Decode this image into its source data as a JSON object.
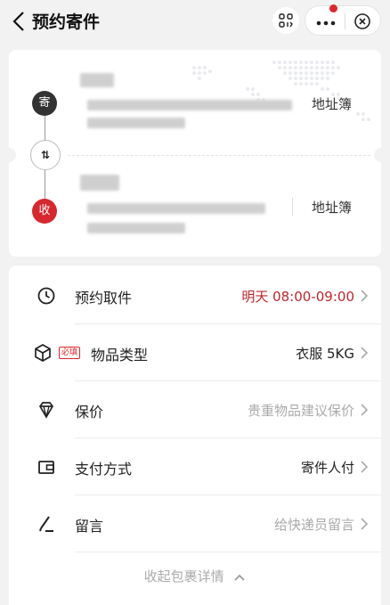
{
  "header": {
    "title": "预约寄件",
    "icons": {
      "back": "chevron-left-icon",
      "scan": "scan-icon",
      "more": "more-icon",
      "close": "close-circle-icon"
    },
    "notify_color": "#e0262a"
  },
  "address": {
    "sender_badge": "寄",
    "receiver_badge": "收",
    "swap_label": "⇅",
    "sender_book": "地址簿",
    "receiver_book": "地址簿",
    "sender_color": "#333333",
    "receiver_color": "#d7282f"
  },
  "form": {
    "rows": [
      {
        "icon": "clock-icon",
        "label": "预约取件",
        "value": "明天 08:00-09:00",
        "style": "red"
      },
      {
        "icon": "box-icon",
        "tag": "必填",
        "label": "物品类型",
        "value": "衣服 5KG",
        "style": "normal"
      },
      {
        "icon": "diamond-icon",
        "label": "保价",
        "value": "贵重物品建议保价",
        "style": "hint"
      },
      {
        "icon": "wallet-icon",
        "label": "支付方式",
        "value": "寄件人付",
        "style": "normal"
      },
      {
        "icon": "pen-icon",
        "label": "留言",
        "value": "给快递员留言",
        "style": "hint"
      }
    ],
    "collapse_label": "收起包裹详情"
  },
  "colors": {
    "accent": "#c0262c",
    "background": "#f2f2f2"
  }
}
